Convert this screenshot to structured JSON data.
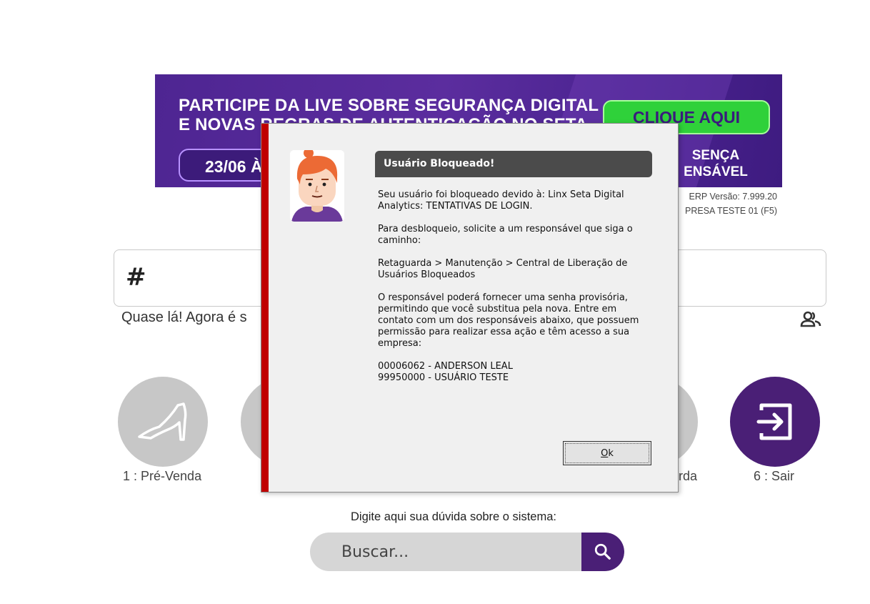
{
  "banner": {
    "headline_line1": "PARTICIPE DA LIVE SOBRE SEGURANÇA DIGITAL",
    "headline_line2": "E NOVAS REGRAS DE AUTENTICAÇÃO NO SETA",
    "date": "23/06 À",
    "cta": "CLIQUE AQUI",
    "presence_line1": "SENÇA",
    "presence_line2": "ENSÁVEL"
  },
  "erp": {
    "version": "ERP Versão: 7.999.20",
    "company": "PRESA TESTE  01 (F5)"
  },
  "code_field": {
    "value": "#"
  },
  "hint": "Quase lá! Agora é s",
  "shortcuts": [
    {
      "label": "1 : Pré-Venda",
      "icon": "high-heel-icon"
    },
    {
      "label": "",
      "icon": ""
    },
    {
      "label": "rda",
      "icon": ""
    },
    {
      "label": "6 : Sair",
      "icon": "exit-icon"
    }
  ],
  "search": {
    "caption": "Digite aqui sua dúvida sobre o sistema:",
    "placeholder": "Buscar..."
  },
  "dialog": {
    "title": "Usuário Bloqueado!",
    "paragraph1": "Seu usuário foi bloqueado devido à: Linx Seta Digital Analytics: TENTATIVAS DE LOGIN.",
    "paragraph2": "Para desbloqueio, solicite a um responsável que siga o caminho:",
    "paragraph3": "Retaguarda > Manutenção > Central de Liberação de Usuários Bloqueados",
    "paragraph4": "O responsável poderá fornecer uma senha provisória, permitindo que você substitua pela nova. Entre em contato com um dos responsáveis abaixo, que possuem permissão para realizar essa ação e têm acesso a sua empresa:",
    "contact1": "00006062 - ANDERSON LEAL",
    "contact2": "99950000 - USUÁRIO TESTE",
    "ok_prefix": "",
    "ok_underlined": "O",
    "ok_suffix": "k"
  },
  "colors": {
    "brand_purple": "#4a1f76",
    "banner_green": "#2fd13a",
    "dialog_stripe": "#c00000"
  }
}
